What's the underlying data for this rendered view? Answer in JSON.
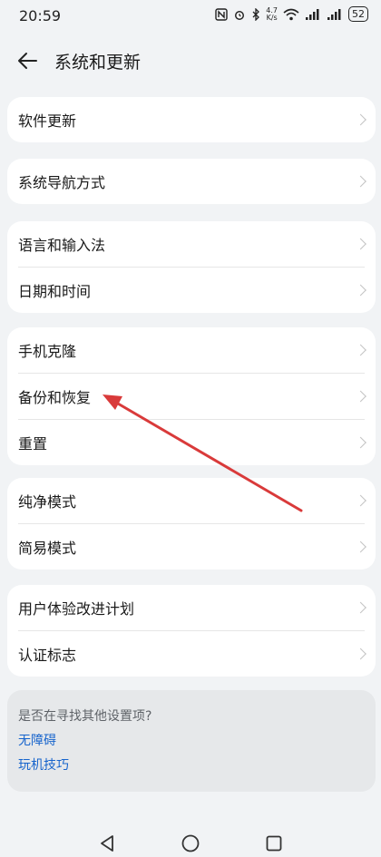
{
  "status": {
    "time": "20:59",
    "speed_value": "4.7",
    "speed_unit": "K/s",
    "battery": "52"
  },
  "header": {
    "title": "系统和更新"
  },
  "groups": [
    {
      "items": [
        "软件更新"
      ]
    },
    {
      "items": [
        "系统导航方式"
      ]
    },
    {
      "items": [
        "语言和输入法",
        "日期和时间"
      ]
    },
    {
      "items": [
        "手机克隆",
        "备份和恢复",
        "重置"
      ]
    },
    {
      "items": [
        "纯净模式",
        "简易模式"
      ]
    },
    {
      "items": [
        "用户体验改进计划",
        "认证标志"
      ]
    }
  ],
  "suggestions": {
    "question": "是否在寻找其他设置项?",
    "links": [
      "无障碍",
      "玩机技巧"
    ]
  },
  "icons": {
    "back": "back-arrow-icon",
    "chevron": "chevron-right-icon",
    "nav_back": "triangle-back-icon",
    "nav_home": "circle-home-icon",
    "nav_recent": "square-recent-icon"
  },
  "colors": {
    "background": "#f1f3f5",
    "card": "#ffffff",
    "link": "#1764cc",
    "annotation_arrow": "#d93a3a"
  }
}
